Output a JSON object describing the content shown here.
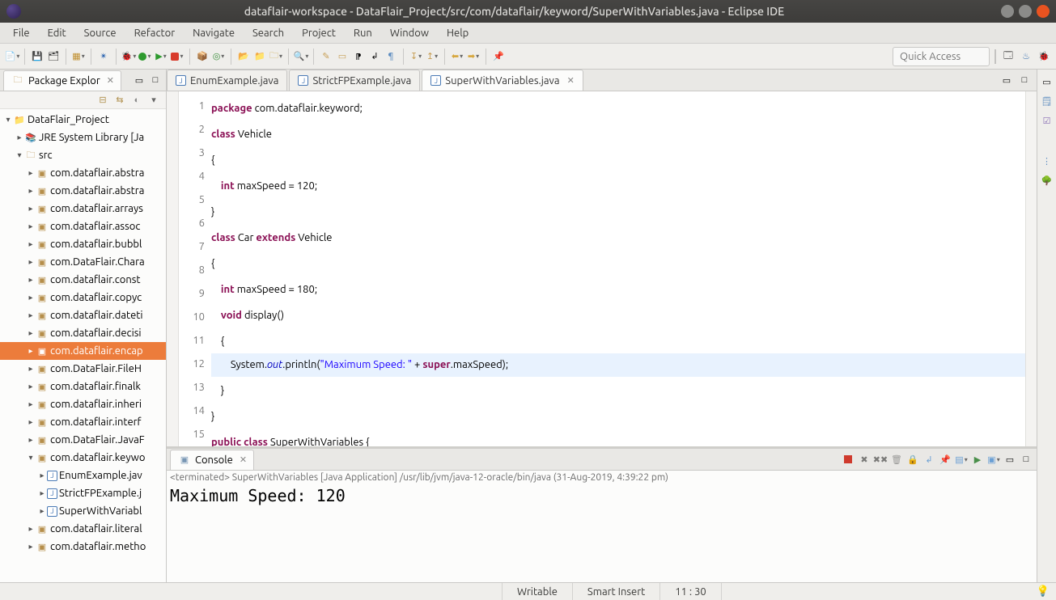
{
  "window": {
    "title": "dataflair-workspace - DataFlair_Project/src/com/dataflair/keyword/SuperWithVariables.java - Eclipse IDE"
  },
  "menu": [
    "File",
    "Edit",
    "Source",
    "Refactor",
    "Navigate",
    "Search",
    "Project",
    "Run",
    "Window",
    "Help"
  ],
  "quick_access_placeholder": "Quick Access",
  "explorer": {
    "title": "Package Explor",
    "tree": {
      "project": "DataFlair_Project",
      "jre": "JRE System Library [Ja",
      "src": "src",
      "packages": [
        "com.dataflair.abstra",
        "com.dataflair.abstra",
        "com.dataflair.arrays",
        "com.dataflair.assoc",
        "com.dataflair.bubbl",
        "com.DataFlair.Chara",
        "com.dataflair.const",
        "com.dataflair.copyc",
        "com.dataflair.dateti",
        "com.dataflair.decisi",
        "com.dataflair.encap",
        "com.DataFlair.FileH",
        "com.dataflair.finalk",
        "com.dataflair.inheri",
        "com.dataflair.interf",
        "com.DataFlair.JavaF",
        "com.dataflair.keywo"
      ],
      "keyword_children": [
        "EnumExample.jav",
        "StrictFPExample.j",
        "SuperWithVariabl"
      ],
      "packages_tail": [
        "com.dataflair.literal",
        "com.dataflair.metho"
      ]
    }
  },
  "editor": {
    "tabs": [
      "EnumExample.java",
      "StrictFPExample.java",
      "SuperWithVariables.java"
    ],
    "active_tab": 2,
    "code_lines": [
      {
        "n": 1,
        "tokens": [
          [
            "kw",
            "package"
          ],
          [
            "",
            " com.dataflair.keyword;"
          ]
        ]
      },
      {
        "n": 2,
        "tokens": [
          [
            "kw",
            "class"
          ],
          [
            "",
            " Vehicle"
          ]
        ]
      },
      {
        "n": 3,
        "tokens": [
          [
            "",
            "{"
          ]
        ]
      },
      {
        "n": 4,
        "tokens": [
          [
            "",
            "    "
          ],
          [
            "kw",
            "int"
          ],
          [
            "",
            " maxSpeed = 120;"
          ]
        ]
      },
      {
        "n": 5,
        "tokens": [
          [
            "",
            "}"
          ]
        ]
      },
      {
        "n": 6,
        "tokens": [
          [
            "kw",
            "class"
          ],
          [
            "",
            " Car "
          ],
          [
            "kw",
            "extends"
          ],
          [
            "",
            " Vehicle"
          ]
        ]
      },
      {
        "n": 7,
        "tokens": [
          [
            "",
            "{"
          ]
        ]
      },
      {
        "n": 8,
        "tokens": [
          [
            "",
            "    "
          ],
          [
            "kw",
            "int"
          ],
          [
            "",
            " maxSpeed = 180;"
          ]
        ]
      },
      {
        "n": 9,
        "tokens": [
          [
            "",
            "    "
          ],
          [
            "kw",
            "void"
          ],
          [
            "",
            " display()"
          ]
        ]
      },
      {
        "n": 10,
        "tokens": [
          [
            "",
            "    {"
          ]
        ]
      },
      {
        "n": 11,
        "hl": true,
        "tokens": [
          [
            "",
            "        System."
          ],
          [
            "fld",
            "out"
          ],
          [
            "",
            ".println("
          ],
          [
            "st",
            "\"Maximum Speed: \""
          ],
          [
            "",
            " + "
          ],
          [
            "kw",
            "super"
          ],
          [
            "",
            ".maxSpeed);"
          ]
        ]
      },
      {
        "n": 12,
        "tokens": [
          [
            "",
            "    }"
          ]
        ]
      },
      {
        "n": 13,
        "tokens": [
          [
            "",
            "}"
          ]
        ]
      },
      {
        "n": 14,
        "tokens": [
          [
            "kw",
            "public"
          ],
          [
            "",
            " "
          ],
          [
            "kw",
            "class"
          ],
          [
            "",
            " SuperWithVariables {"
          ]
        ]
      },
      {
        "n": 15,
        "tokens": [
          [
            "",
            ""
          ]
        ]
      }
    ]
  },
  "console": {
    "title": "Console",
    "info": "<terminated> SuperWithVariables [Java Application] /usr/lib/jvm/java-12-oracle/bin/java (31-Aug-2019, 4:39:22 pm)",
    "output": "Maximum Speed: 120"
  },
  "status": {
    "mode": "Writable",
    "insert": "Smart Insert",
    "pos": "11 : 30"
  }
}
